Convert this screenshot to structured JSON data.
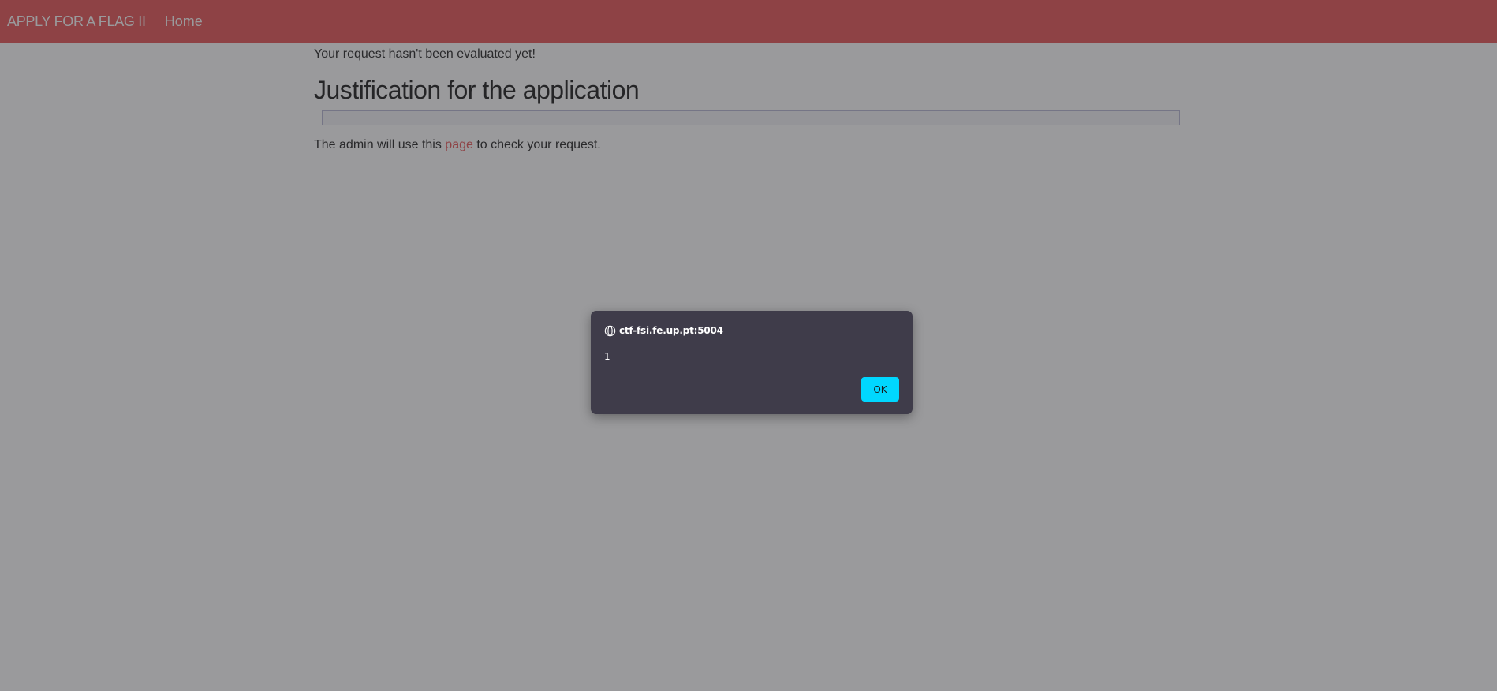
{
  "navbar": {
    "brand": "APPLY FOR A FLAG II",
    "links": [
      {
        "label": "Home"
      }
    ]
  },
  "main": {
    "status_text": "Your request hasn't been evaluated yet!",
    "heading": "Justification for the application",
    "justification_value": "",
    "admin_text_before": "The admin will use this ",
    "admin_link_label": "page",
    "admin_text_after": " to check your request."
  },
  "dialog": {
    "origin": "ctf-fsi.fe.up.pt:5004",
    "message": "1",
    "ok_label": "OK",
    "icon": "globe-icon"
  },
  "colors": {
    "navbar": "#e85a5c",
    "link": "#e85a5c",
    "dialog_bg": "#3f3c4a",
    "ok_button": "#00d7ff"
  }
}
